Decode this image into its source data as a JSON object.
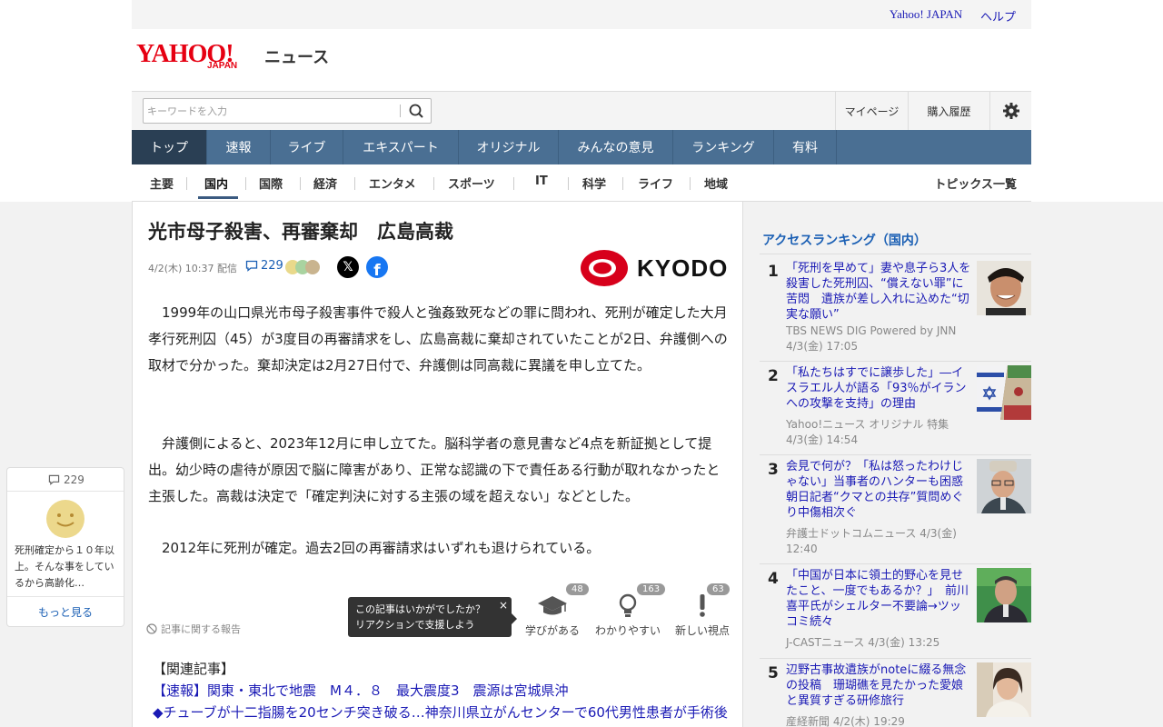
{
  "util": {
    "yahoo_japan": "Yahoo! JAPAN",
    "help": "ヘルプ"
  },
  "logo": {
    "yahoo": "YAHOO!",
    "japan": "JAPAN",
    "news": "ニュース"
  },
  "search": {
    "placeholder": "キーワードを入力"
  },
  "header_buttons": {
    "mypage": "マイページ",
    "history": "購入履歴"
  },
  "global_nav": [
    "トップ",
    "速報",
    "ライブ",
    "エキスパート",
    "オリジナル",
    "みんなの意見",
    "ランキング",
    "有料"
  ],
  "sub_nav": [
    "主要",
    "国内",
    "国際",
    "経済",
    "エンタメ",
    "スポーツ",
    "IT",
    "科学",
    "ライフ",
    "地域"
  ],
  "sub_nav_topics": "トピックス一覧",
  "article": {
    "title": "光市母子殺害、再審棄却　広島高裁",
    "meta": "4/2(木) 10:37 配信",
    "comment_count": "229",
    "source": "KYODO",
    "paragraphs": [
      "　1999年の山口県光市母子殺害事件で殺人と強姦致死などの罪に問われ、死刑が確定した大月孝行死刑囚（45）が3度目の再審請求をし、広島高裁に棄却されていたことが2日、弁護側への取材で分かった。棄却決定は2月27日付で、弁護側は同高裁に異議を申し立てた。",
      "　弁護側によると、2023年12月に申し立てた。脳科学者の意見書など4点を新証拠として提出。幼少時の虐待が原因で脳に障害があり、正常な認識の下で責任ある行動が取れなかったと主張した。高裁は決定で「確定判決に対する主張の域を超えない」などとした。",
      "　2012年に死刑が確定。過去2回の再審請求はいずれも退けられている。"
    ],
    "report": "記事に関する報告",
    "tooltip": {
      "line1": "この記事はいかがでしたか？",
      "line2": "リアクションで支援しよう",
      "close": "×"
    },
    "reactions": [
      {
        "label": "学びがある",
        "count": "48",
        "icon": "graduation-cap-icon"
      },
      {
        "label": "わかりやすい",
        "count": "163",
        "icon": "lightbulb-icon"
      },
      {
        "label": "新しい視点",
        "count": "63",
        "icon": "exclamation-icon"
      }
    ],
    "related_heading": "【関連記事】",
    "related": [
      "【速報】関東・東北で地震　M４．８　最大震度3　震源は宮城県沖",
      "◆チューブが十二指腸を20センチ突き破る…神奈川県立がんセンターで60代男性患者が手術後"
    ]
  },
  "float_card": {
    "count": "229",
    "text": "死刑確定から１０年以上。そんな事をしているから高齢化…",
    "more": "もっと見る"
  },
  "ranking": {
    "title": "アクセスランキング（国内）",
    "items": [
      {
        "rank": "1",
        "title": "「死刑を早めて」妻や息子ら3人を殺害した死刑囚、“償えない罪”に苦悶　遺族が差し入れに込めた“切実な願い”",
        "source": "TBS NEWS DIG Powered by JNN",
        "date": "4/3(金) 17:05"
      },
      {
        "rank": "2",
        "title": "「私たちはすでに譲歩した」―イスラエル人が語る「93％がイランへの攻撃を支持」の理由",
        "source": "Yahoo!ニュース オリジナル 特集",
        "date": "4/3(金) 14:54"
      },
      {
        "rank": "3",
        "title": "会見で何が？「私は怒ったわけじゃない」当事者のハンターも困惑 朝日記者“クマとの共存”質問めぐり中傷相次ぐ",
        "source": "弁護士ドットコムニュース 4/3(金)",
        "date": "12:40"
      },
      {
        "rank": "4",
        "title": "「中国が日本に領土的野心を見せたこと、一度でもあるか？」　前川喜平氏がシェルター不要論→ツッコミ続々",
        "source": "J-CASTニュース 4/3(金) 13:25",
        "date": ""
      },
      {
        "rank": "5",
        "title": "辺野古事故遺族がnoteに綴る無念の投稿　珊瑚礁を見たかった愛娘と異質すぎる研修旅行",
        "source": "産経新聞 4/2(木) 19:29",
        "date": ""
      }
    ]
  },
  "colors": {
    "nav_bg": "#4a6f93",
    "nav_active": "#2a3f54",
    "link": "#1a1ab5",
    "brand_red": "#e60012"
  }
}
